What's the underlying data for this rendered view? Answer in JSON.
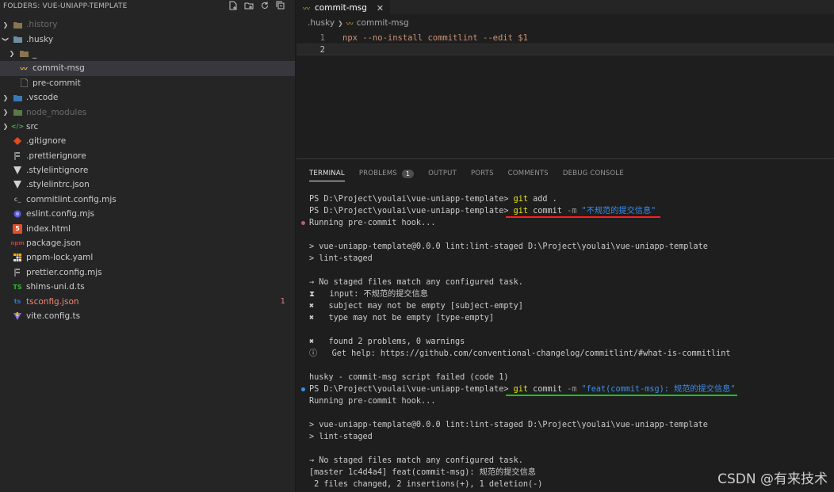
{
  "explorer": {
    "title": "FOLDERS: VUE-UNIAPP-TEMPLATE",
    "actions": [
      "new-file-icon",
      "new-folder-icon",
      "refresh-icon",
      "collapse-all-icon"
    ],
    "items": [
      {
        "label": ".history",
        "icon": "folder-icon"
      },
      {
        "label": ".husky",
        "icon": "folder-husky-icon"
      },
      {
        "label": "_",
        "icon": "folder-icon"
      },
      {
        "label": "commit-msg",
        "icon": "git-hook-icon"
      },
      {
        "label": "pre-commit",
        "icon": "file-icon"
      },
      {
        "label": ".vscode",
        "icon": "folder-vscode-icon"
      },
      {
        "label": "node_modules",
        "icon": "folder-node-icon"
      },
      {
        "label": "src",
        "icon": "folder-src-icon"
      },
      {
        "label": ".gitignore",
        "icon": "git-icon"
      },
      {
        "label": ".prettierignore",
        "icon": "prettier-icon"
      },
      {
        "label": ".stylelintignore",
        "icon": "stylelint-icon"
      },
      {
        "label": ".stylelintrc.json",
        "icon": "stylelint-icon"
      },
      {
        "label": "commitlint.config.mjs",
        "icon": "commitlint-icon"
      },
      {
        "label": "eslint.config.mjs",
        "icon": "eslint-icon"
      },
      {
        "label": "index.html",
        "icon": "html-icon"
      },
      {
        "label": "package.json",
        "icon": "npm-icon"
      },
      {
        "label": "pnpm-lock.yaml",
        "icon": "pnpm-icon"
      },
      {
        "label": "prettier.config.mjs",
        "icon": "prettier-icon"
      },
      {
        "label": "shims-uni.d.ts",
        "icon": "typescript-icon"
      },
      {
        "label": "tsconfig.json",
        "icon": "tsconfig-icon",
        "count": "1"
      },
      {
        "label": "vite.config.ts",
        "icon": "vite-icon"
      }
    ]
  },
  "editor": {
    "tab_label": "commit-msg",
    "breadcrumb": [
      ".husky",
      "commit-msg"
    ],
    "lines": [
      {
        "num": "1",
        "text": "npx --no-install commitlint --edit $1"
      },
      {
        "num": "2",
        "text": ""
      }
    ]
  },
  "panel": {
    "tabs": [
      "TERMINAL",
      "PROBLEMS",
      "OUTPUT",
      "PORTS",
      "COMMENTS",
      "DEBUG CONSOLE"
    ],
    "problems_count": "1"
  },
  "terminal": {
    "l1_prompt": "PS D:\\Project\\youlai\\vue-uniapp-template> ",
    "l1_cmd": "git",
    "l1_rest": " add .",
    "l2_prompt": "PS D:\\Project\\youlai\\vue-uniapp-template> ",
    "l2_git": "git",
    "l2_commit": " commit ",
    "l2_flag": "-m",
    "l2_msg": " \"不规范的提交信息\"",
    "l3": "Running pre-commit hook...",
    "l5": "> vue-uniapp-template@0.0.0 lint:lint-staged D:\\Project\\youlai\\vue-uniapp-template",
    "l6": "> lint-staged",
    "l8": "→ No staged files match any configured task.",
    "l9": "⧗   input: 不规范的提交信息",
    "l10": "✖   subject may not be empty [subject-empty]",
    "l11": "✖   type may not be empty [type-empty]",
    "l13": "✖   found 2 problems, 0 warnings",
    "l14": "ⓘ   Get help: https://github.com/conventional-changelog/commitlint/#what-is-commitlint",
    "l16": "husky - commit-msg script failed (code 1)",
    "l17_prompt": "PS D:\\Project\\youlai\\vue-uniapp-template> ",
    "l17_git": "git",
    "l17_commit": " commit ",
    "l17_flag": "-m",
    "l17_msg": " \"feat(commit-msg): 规范的提交信息\"",
    "l18": "Running pre-commit hook...",
    "l20": "> vue-uniapp-template@0.0.0 lint:lint-staged D:\\Project\\youlai\\vue-uniapp-template",
    "l21": "> lint-staged",
    "l23": "→ No staged files match any configured task.",
    "l24": "[master 1c4d4a4] feat(commit-msg): 规范的提交信息",
    "l25": " 2 files changed, 2 insertions(+), 1 deletion(-)"
  },
  "watermark": "CSDN @有来技术",
  "colors": {
    "accent_yellow": "#e5e510",
    "accent_cyan": "#3b8eea",
    "underline_red": "#ff1e1e",
    "underline_green": "#18c418"
  }
}
